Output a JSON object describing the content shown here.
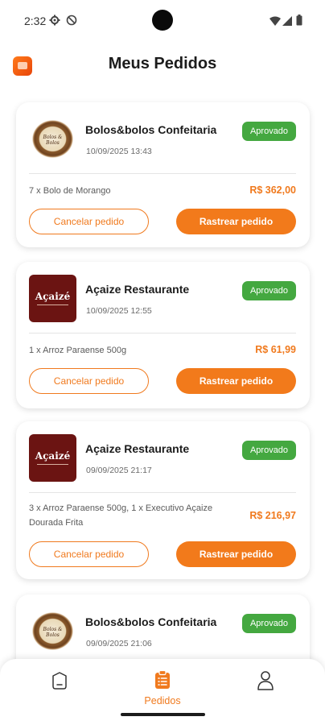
{
  "status_bar": {
    "time": "2:32",
    "icons": [
      "gear-icon",
      "do-not-disturb-icon",
      "wifi-icon",
      "signal-icon",
      "battery-icon"
    ]
  },
  "header": {
    "title": "Meus Pedidos",
    "logo_icon": "app-logo-icon"
  },
  "colors": {
    "accent": "#f27a1b",
    "status_approved": "#44a840"
  },
  "orders": [
    {
      "store": "Bolos&bolos Confeitaria",
      "logo": "bolos",
      "logo_text": "Bolos & Bolos",
      "date": "10/09/2025 13:43",
      "status": "Aprovado",
      "items": "7 x Bolo de Morango",
      "total": "R$ 362,00",
      "cancel_label": "Cancelar pedido",
      "track_label": "Rastrear pedido"
    },
    {
      "store": "Açaize Restaurante",
      "logo": "acaize",
      "logo_text": "Açaizé",
      "date": "10/09/2025 12:55",
      "status": "Aprovado",
      "items": "1 x Arroz Paraense 500g",
      "total": "R$ 61,99",
      "cancel_label": "Cancelar pedido",
      "track_label": "Rastrear pedido"
    },
    {
      "store": "Açaize Restaurante",
      "logo": "acaize",
      "logo_text": "Açaizé",
      "date": "09/09/2025 21:17",
      "status": "Aprovado",
      "items": "3 x Arroz Paraense 500g, 1 x Executivo Açaize Dourada Frita",
      "total": "R$ 216,97",
      "cancel_label": "Cancelar pedido",
      "track_label": "Rastrear pedido"
    },
    {
      "store": "Bolos&bolos Confeitaria",
      "logo": "bolos",
      "logo_text": "Bolos & Bolos",
      "date": "09/09/2025 21:06",
      "status": "Aprovado"
    }
  ],
  "bottom_nav": {
    "items": [
      {
        "name": "home",
        "icon": "home-icon",
        "label": ""
      },
      {
        "name": "pedidos",
        "icon": "clipboard-icon",
        "label": "Pedidos",
        "active": true
      },
      {
        "name": "profile",
        "icon": "user-icon",
        "label": ""
      }
    ]
  }
}
